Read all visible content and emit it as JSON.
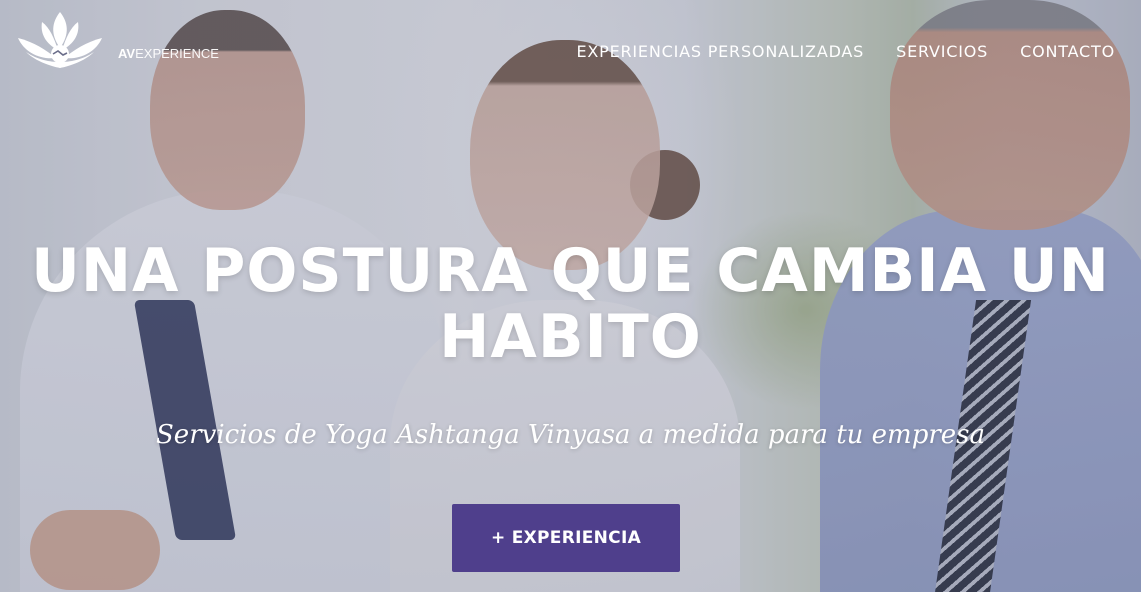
{
  "brand": {
    "logo_icon": "lotus-handshake-icon",
    "name_short": "AV",
    "name_rest": "EXPERIENCE"
  },
  "nav": {
    "items": [
      {
        "label": "EXPERIENCIAS PERSONALIZADAS"
      },
      {
        "label": "SERVICIOS"
      },
      {
        "label": "CONTACTO"
      }
    ]
  },
  "hero": {
    "headline_line1": "UNA POSTURA QUE CAMBIA UN",
    "headline_line2": "HABITO",
    "subtitle": "Servicios de Yoga Ashtanga Vinyasa a medida para tu empresa",
    "cta_label": "+ EXPERIENCIA",
    "background": "meditating-business-people-photo"
  },
  "colors": {
    "accent": "#4f3f8c",
    "text": "#ffffff"
  }
}
